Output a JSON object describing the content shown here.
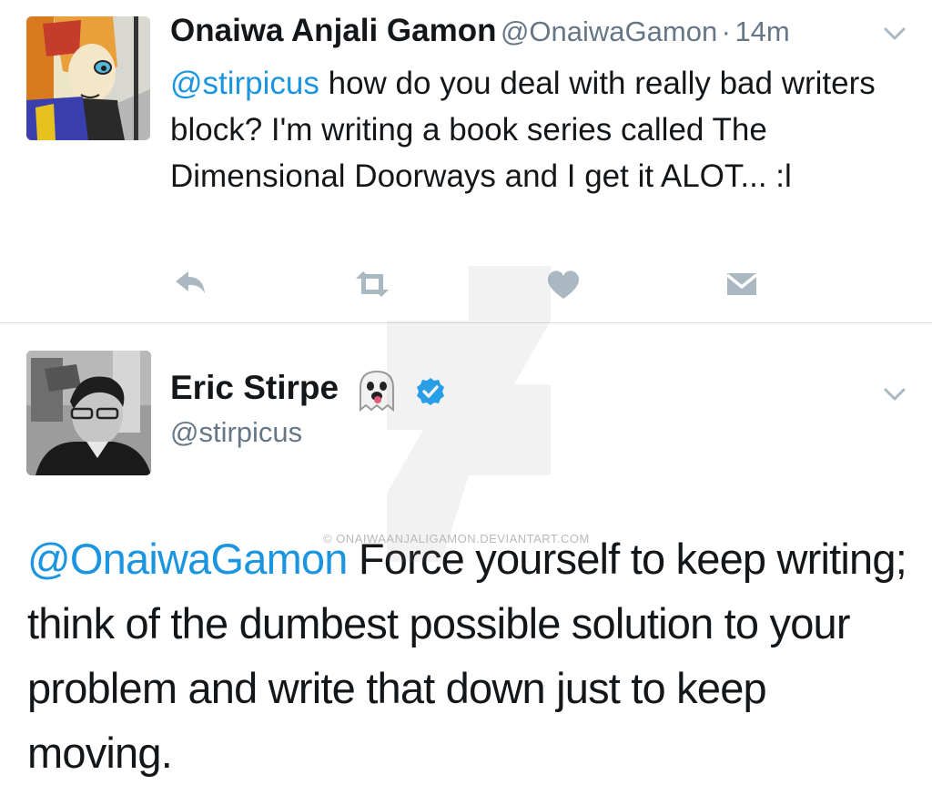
{
  "tweet1": {
    "author_name": "Onaiwa Anjali Gamon",
    "author_handle": "@OnaiwaGamon",
    "separator": "·",
    "time": "14m",
    "mention": "@stirpicus",
    "text": " how do you deal with really bad writers block? I'm writing a book series called The Dimensional Doorways and I get it ALOT... :l",
    "actions": [
      "reply-icon",
      "retweet-icon",
      "like-icon",
      "direct-message-icon"
    ]
  },
  "tweet2": {
    "author_name": "Eric Stirpe",
    "name_emoji": "ghost-emoji",
    "verified": true,
    "author_handle": "@stirpicus",
    "mention": "@OnaiwaGamon",
    "text": " Force yourself to keep writing; think of the dumbest possible solution to your problem and write that down just to keep moving."
  },
  "watermark": {
    "text": "© ONAIWAANJALIGAMON.DEVIANTART.COM"
  },
  "colors": {
    "link": "#1b95e0",
    "secondary_text": "#657786",
    "action_icon": "#aab8c2",
    "verified_badge": "#1da1f2",
    "divider": "#d9dee2"
  }
}
